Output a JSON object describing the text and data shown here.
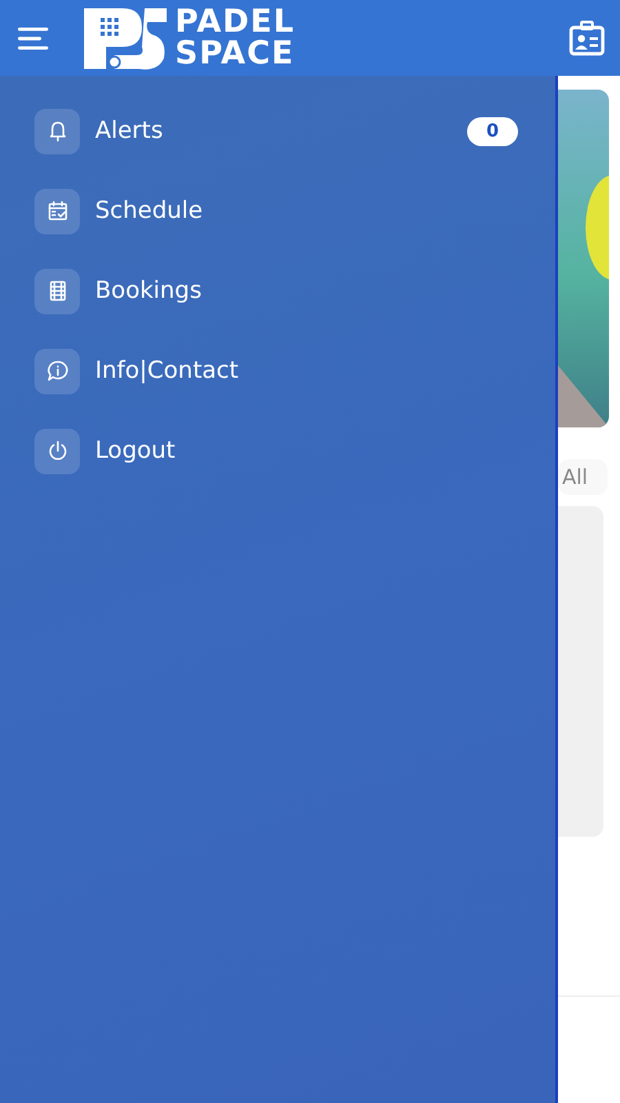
{
  "header": {
    "brand_line_1": "PADEL",
    "brand_line_2": "SPACE"
  },
  "drawer": {
    "items": [
      {
        "kind": "bell",
        "label": "Alerts",
        "badge": "0"
      },
      {
        "kind": "calendar",
        "label": "Schedule"
      },
      {
        "kind": "film",
        "label": "Bookings"
      },
      {
        "kind": "chat",
        "label": "Info|Contact"
      },
      {
        "kind": "power",
        "label": "Logout"
      }
    ]
  },
  "background": {
    "chip": "All"
  }
}
